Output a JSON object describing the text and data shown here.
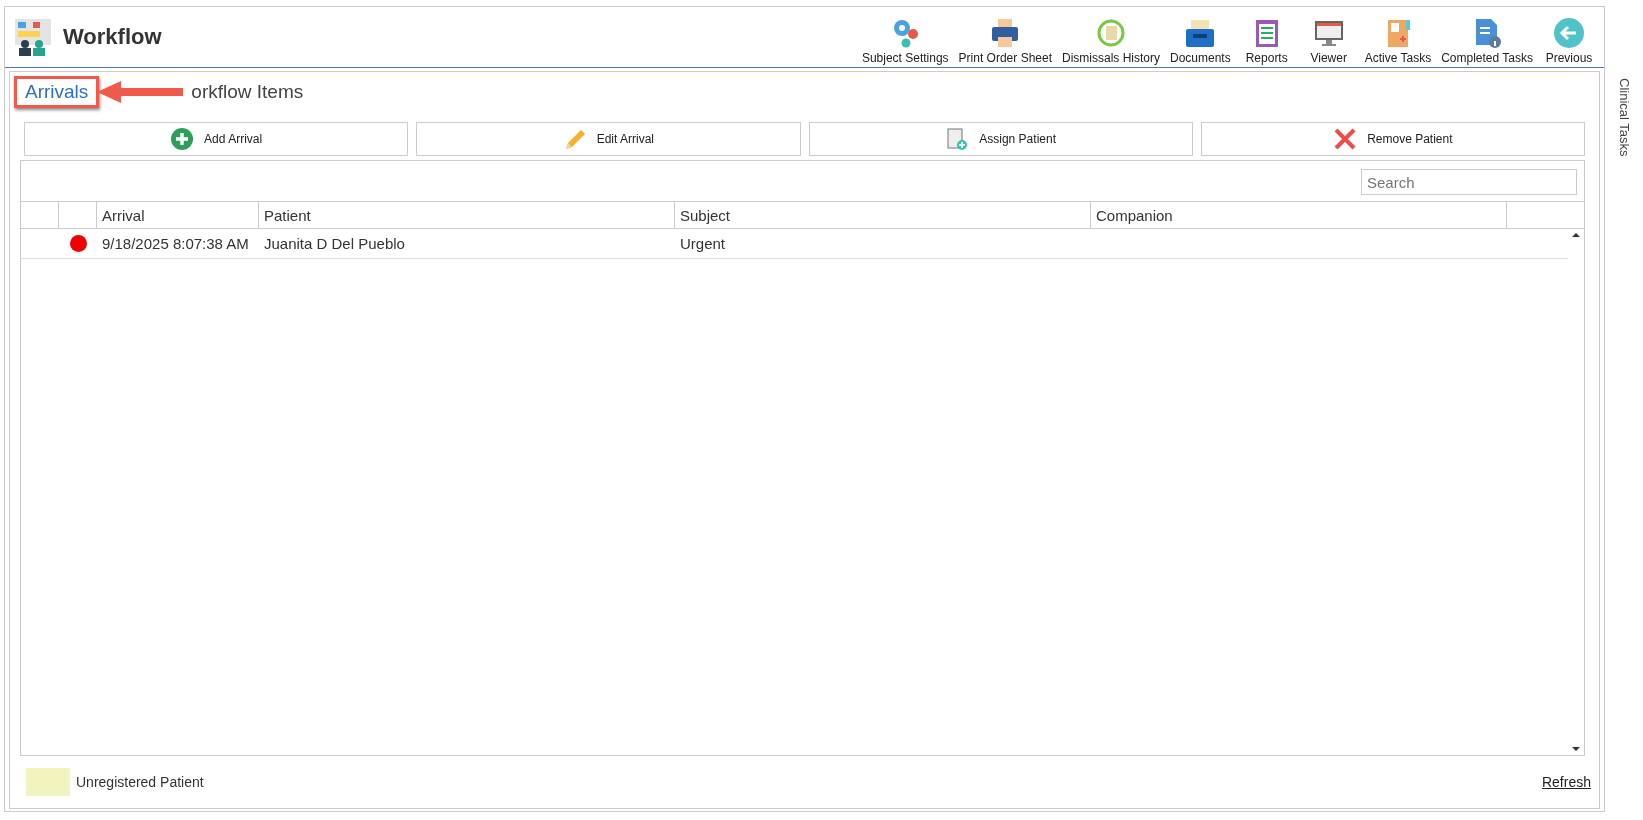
{
  "app": {
    "title": "Workflow"
  },
  "toolbar": [
    {
      "label": "Subject Settings",
      "kind": "gears"
    },
    {
      "label": "Print Order Sheet",
      "kind": "printer"
    },
    {
      "label": "Dismissals History",
      "kind": "history"
    },
    {
      "label": "Documents",
      "kind": "tray"
    },
    {
      "label": "Reports",
      "kind": "clipboard"
    },
    {
      "label": "Viewer",
      "kind": "monitor"
    },
    {
      "label": "Active Tasks",
      "kind": "folder"
    },
    {
      "label": "Completed Tasks",
      "kind": "doc"
    },
    {
      "label": "Previous",
      "kind": "back"
    }
  ],
  "tabs": [
    {
      "label": "Arrivals",
      "selected": true
    },
    {
      "label": "orkflow Items",
      "selected": false
    }
  ],
  "actions": [
    {
      "label": "Add Arrival",
      "kind": "add"
    },
    {
      "label": "Edit Arrival",
      "kind": "edit"
    },
    {
      "label": "Assign Patient",
      "kind": "assign"
    },
    {
      "label": "Remove Patient",
      "kind": "remove"
    }
  ],
  "search": {
    "placeholder": "Search"
  },
  "table": {
    "columns": [
      "Arrival",
      "Patient",
      "Subject",
      "Companion"
    ],
    "rows": [
      {
        "color": "#ee0000",
        "cells": [
          "9/18/2025 8:07:38 AM",
          "Juanita D Del Pueblo",
          "Urgent",
          ""
        ]
      }
    ]
  },
  "legend": {
    "label": "Unregistered Patient",
    "color": "#f3f3c0"
  },
  "refresh": "Refresh",
  "side_panel": {
    "label": "Clinical Tasks"
  }
}
